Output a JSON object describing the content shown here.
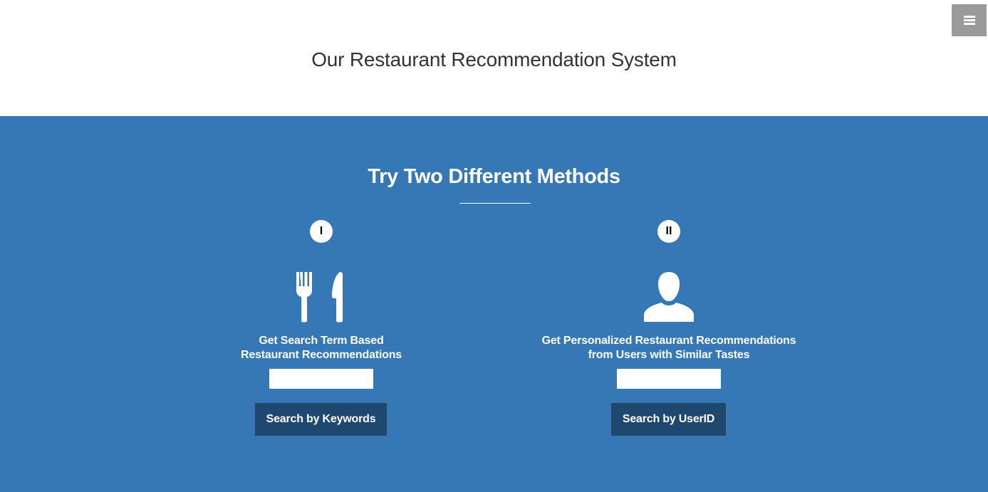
{
  "header": {
    "title": "Our Restaurant Recommendation System",
    "menu_icon": "hamburger-menu-icon"
  },
  "main": {
    "title": "Try Two Different Methods",
    "background_color": "#3578b5",
    "methods": [
      {
        "numeral": "I",
        "icon": "fork-knife-icon",
        "description_lines": [
          "Get Search Term Based",
          "Restaurant Recommendations"
        ],
        "input_value": "",
        "input_placeholder": "",
        "button_label": "Search by Keywords"
      },
      {
        "numeral": "II",
        "icon": "user-icon",
        "description_lines": [
          "Get Personalized Restaurant Recommendations",
          "from Users with Similar Tastes"
        ],
        "input_value": "",
        "input_placeholder": "",
        "button_label": "Search by UserID"
      }
    ]
  },
  "colors": {
    "accent_blue": "#3578b5",
    "button_dark_blue": "#1e4870",
    "menu_gray": "#9a9a9a"
  }
}
